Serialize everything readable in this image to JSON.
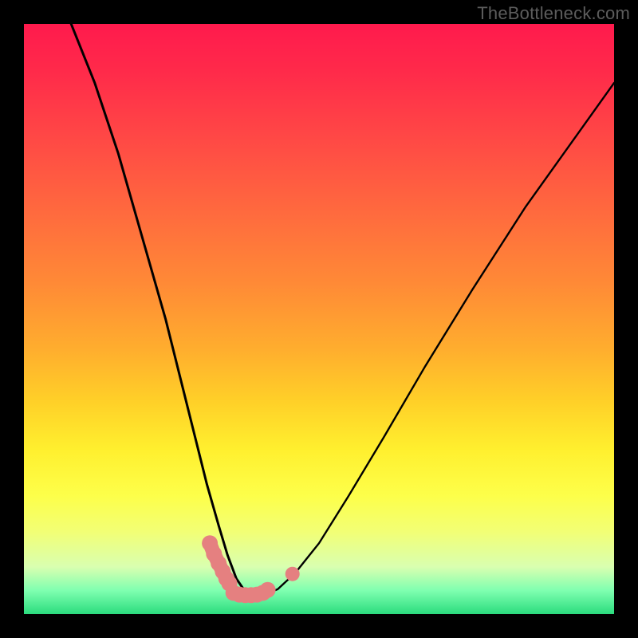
{
  "watermark": "TheBottleneck.com",
  "chart_data": {
    "type": "line",
    "title": "",
    "xlabel": "",
    "ylabel": "",
    "xlim": [
      0,
      100
    ],
    "ylim": [
      0,
      100
    ],
    "notes": "Axes are implicit/percent-like; no tick labels visible. Two black curves form a V with minimum near the bottom (green) band; small pink marker segments sit near the trough.",
    "series": [
      {
        "name": "left-curve",
        "x": [
          8,
          12,
          16,
          20,
          24,
          27,
          29,
          31,
          33,
          34.5,
          36,
          37.5,
          38.8
        ],
        "y": [
          100,
          90,
          78,
          64,
          50,
          38,
          30,
          22,
          15,
          10,
          6,
          3.8,
          3.2
        ]
      },
      {
        "name": "right-curve",
        "x": [
          38.8,
          41,
          43,
          46,
          50,
          55,
          61,
          68,
          76,
          85,
          95,
          100
        ],
        "y": [
          3.2,
          3.4,
          4.2,
          7,
          12,
          20,
          30,
          42,
          55,
          69,
          83,
          90
        ]
      },
      {
        "name": "markers-left",
        "x": [
          31.5,
          32.2,
          33.0,
          33.7,
          34.3,
          34.8
        ],
        "y": [
          12.0,
          10.2,
          8.6,
          7.2,
          6.0,
          5.2
        ]
      },
      {
        "name": "markers-bottom",
        "x": [
          35.5,
          36.5,
          37.5,
          38.5,
          39.5,
          40.5,
          41.3
        ],
        "y": [
          3.6,
          3.3,
          3.2,
          3.2,
          3.3,
          3.6,
          4.1
        ]
      },
      {
        "name": "marker-right-dot",
        "x": [
          45.5
        ],
        "y": [
          6.8
        ]
      }
    ],
    "colors": {
      "curve": "#000000",
      "marker": "#e58080",
      "gradient_top": "#ff1a4d",
      "gradient_mid": "#ffef2e",
      "gradient_bottom": "#2bdc7e"
    }
  }
}
